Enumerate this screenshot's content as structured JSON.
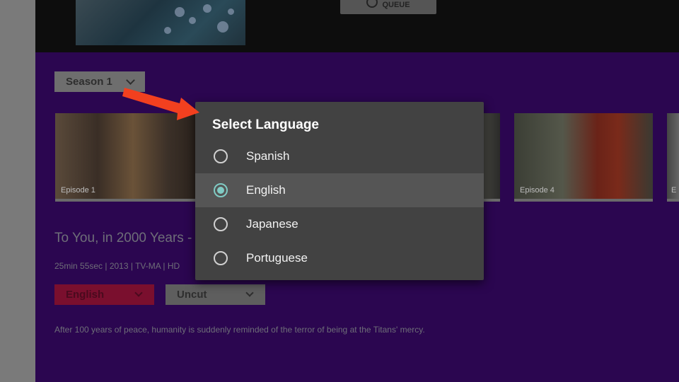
{
  "hero": {
    "queue_label": "QUEUE"
  },
  "season_selector": {
    "label": "Season 1"
  },
  "episodes": [
    {
      "label": "Episode 1"
    },
    {
      "label": ""
    },
    {
      "label": "Episode 4"
    },
    {
      "label": "E"
    }
  ],
  "episode": {
    "title": "To You, in 2000 Years -",
    "meta": "25min 55sec | 2013 | TV-MA | HD",
    "description": "After 100 years of peace, humanity is suddenly reminded of the terror of being at the Titans' mercy."
  },
  "dropdowns": {
    "language_value": "English",
    "cut_value": "Uncut"
  },
  "dialog": {
    "title": "Select Language",
    "options": [
      {
        "label": "Spanish",
        "selected": false
      },
      {
        "label": "English",
        "selected": true
      },
      {
        "label": "Japanese",
        "selected": false
      },
      {
        "label": "Portuguese",
        "selected": false
      }
    ]
  },
  "colors": {
    "background_purple": "#2b0650",
    "accent_red": "#7a0f2e",
    "radio_accent": "#80cbc4",
    "annotation_arrow": "#f2401f"
  },
  "icons": [
    "queue-icon",
    "chevron-down-icon",
    "radio-button-icon",
    "annotation-arrow-icon"
  ]
}
